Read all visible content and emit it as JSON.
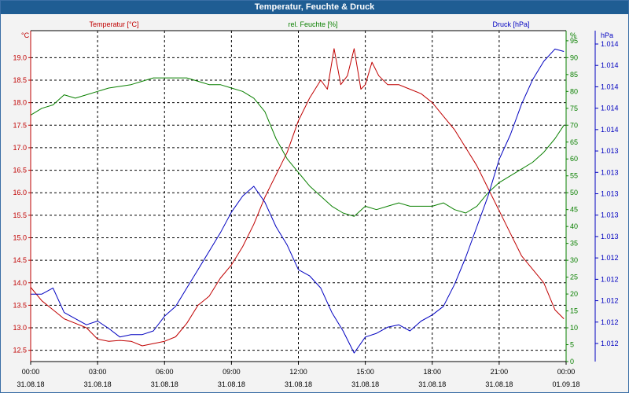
{
  "window": {
    "title": "Temperatur, Feuchte & Druck"
  },
  "chart_data": {
    "type": "line",
    "title": "Temperatur, Feuchte & Druck",
    "x_unit": "hours since 31.08.18 00:00",
    "x_range": [
      0,
      24
    ],
    "x_ticks": [
      {
        "time": "00:00",
        "date": "31.08.18"
      },
      {
        "time": "03:00",
        "date": "31.08.18"
      },
      {
        "time": "06:00",
        "date": "31.08.18"
      },
      {
        "time": "09:00",
        "date": "31.08.18"
      },
      {
        "time": "12:00",
        "date": "31.08.18"
      },
      {
        "time": "15:00",
        "date": "31.08.18"
      },
      {
        "time": "18:00",
        "date": "31.08.18"
      },
      {
        "time": "21:00",
        "date": "31.08.18"
      },
      {
        "time": "00:00",
        "date": "01.09.18"
      }
    ],
    "grid": true,
    "axes": {
      "temperature": {
        "label": "Temperatur [°C]",
        "unit": "°C",
        "side": "left",
        "color": "#c00000",
        "range": [
          12.25,
          19.6
        ],
        "ticks": [
          "19.0",
          "18.5",
          "18.0",
          "17.5",
          "17.0",
          "16.5",
          "16.0",
          "15.5",
          "15.0",
          "14.5",
          "14.0",
          "13.5",
          "13.0",
          "12.5"
        ]
      },
      "humidity": {
        "label": "rel. Feuchte [%]",
        "unit": "%",
        "side": "right",
        "color": "#0a8000",
        "range": [
          0,
          98
        ],
        "ticks": [
          "95",
          "90",
          "85",
          "80",
          "75",
          "70",
          "65",
          "60",
          "55",
          "50",
          "45",
          "40",
          "35",
          "30",
          "25",
          "20",
          "15",
          "10",
          "5",
          "0"
        ]
      },
      "pressure": {
        "label": "Druck [hPa]",
        "unit": "hPa",
        "side": "right-outer",
        "color": "#0000c0",
        "range": [
          1011.75,
          1014.45
        ],
        "ticks": [
          "1.014",
          "1.014",
          "1.014",
          "1.014",
          "1.014",
          "1.013",
          "1.013",
          "1.013",
          "1.013",
          "1.013",
          "1.012",
          "1.012",
          "1.012",
          "1.012",
          "1.012"
        ]
      }
    },
    "series": [
      {
        "name": "Temperatur [°C]",
        "axis": "temperature",
        "color": "#c00000",
        "x": [
          0,
          0.5,
          1,
          1.5,
          2,
          2.5,
          3,
          3.5,
          4,
          4.5,
          5,
          5.5,
          6,
          6.5,
          7,
          7.5,
          8,
          8.5,
          9,
          9.5,
          10,
          10.5,
          11,
          11.5,
          12,
          12.5,
          13,
          13.3,
          13.6,
          13.9,
          14.2,
          14.5,
          14.8,
          15,
          15.3,
          15.6,
          16,
          16.5,
          17,
          17.5,
          18,
          18.5,
          19,
          19.5,
          20,
          20.5,
          21,
          21.5,
          22,
          22.5,
          23,
          23.5,
          23.9
        ],
        "values": [
          13.9,
          13.6,
          13.4,
          13.2,
          13.1,
          13.0,
          12.75,
          12.7,
          12.72,
          12.7,
          12.6,
          12.65,
          12.7,
          12.8,
          13.1,
          13.5,
          13.7,
          14.1,
          14.4,
          14.8,
          15.3,
          15.9,
          16.4,
          16.9,
          17.6,
          18.1,
          18.5,
          18.3,
          19.2,
          18.4,
          18.6,
          19.2,
          18.3,
          18.4,
          18.9,
          18.6,
          18.4,
          18.4,
          18.3,
          18.2,
          18.0,
          17.7,
          17.4,
          17.0,
          16.6,
          16.1,
          15.6,
          15.1,
          14.6,
          14.3,
          14.0,
          13.4,
          13.2
        ]
      },
      {
        "name": "rel. Feuchte [%]",
        "axis": "humidity",
        "color": "#0a8000",
        "x": [
          0,
          0.5,
          1,
          1.5,
          2,
          2.5,
          3,
          3.5,
          4,
          4.5,
          5,
          5.5,
          6,
          6.5,
          7,
          7.5,
          8,
          8.5,
          9,
          9.5,
          10,
          10.5,
          11,
          11.5,
          12,
          12.5,
          13,
          13.5,
          14,
          14.5,
          15,
          15.5,
          16,
          16.5,
          17,
          17.5,
          18,
          18.5,
          19,
          19.5,
          20,
          20.5,
          21,
          21.5,
          22,
          22.5,
          23,
          23.5,
          23.9
        ],
        "values": [
          73,
          75,
          76,
          79,
          78,
          79,
          80,
          81,
          81.5,
          82,
          83,
          84,
          84,
          84,
          84,
          83,
          82,
          82,
          81,
          80,
          78,
          74,
          66,
          60,
          56,
          52,
          49,
          46,
          44,
          43,
          46,
          45,
          46,
          47,
          46,
          46,
          46,
          47,
          45,
          44,
          46,
          50,
          53,
          55,
          57,
          59,
          62,
          66,
          70
        ]
      },
      {
        "name": "Druck [hPa]",
        "axis": "pressure",
        "color": "#0000c0",
        "x": [
          0,
          0.5,
          1,
          1.5,
          2,
          2.5,
          3,
          3.5,
          4,
          4.5,
          5,
          5.5,
          6,
          6.5,
          7,
          7.5,
          8,
          8.5,
          9,
          9.5,
          10,
          10.5,
          11,
          11.5,
          12,
          12.5,
          13,
          13.5,
          14,
          14.5,
          15,
          15.5,
          16,
          16.5,
          17,
          17.5,
          18,
          18.5,
          19,
          19.5,
          20,
          20.5,
          21,
          21.5,
          22,
          22.5,
          23,
          23.5,
          23.9
        ],
        "values": [
          1012.3,
          1012.3,
          1012.35,
          1012.15,
          1012.1,
          1012.05,
          1012.08,
          1012.02,
          1011.95,
          1011.97,
          1011.97,
          1012.0,
          1012.12,
          1012.2,
          1012.35,
          1012.5,
          1012.65,
          1012.8,
          1012.97,
          1013.1,
          1013.18,
          1013.05,
          1012.85,
          1012.7,
          1012.5,
          1012.45,
          1012.35,
          1012.15,
          1012.0,
          1011.82,
          1011.95,
          1011.98,
          1012.03,
          1012.05,
          1012.0,
          1012.08,
          1012.13,
          1012.2,
          1012.38,
          1012.6,
          1012.85,
          1013.1,
          1013.4,
          1013.6,
          1013.85,
          1014.05,
          1014.2,
          1014.3,
          1014.28
        ]
      }
    ]
  }
}
